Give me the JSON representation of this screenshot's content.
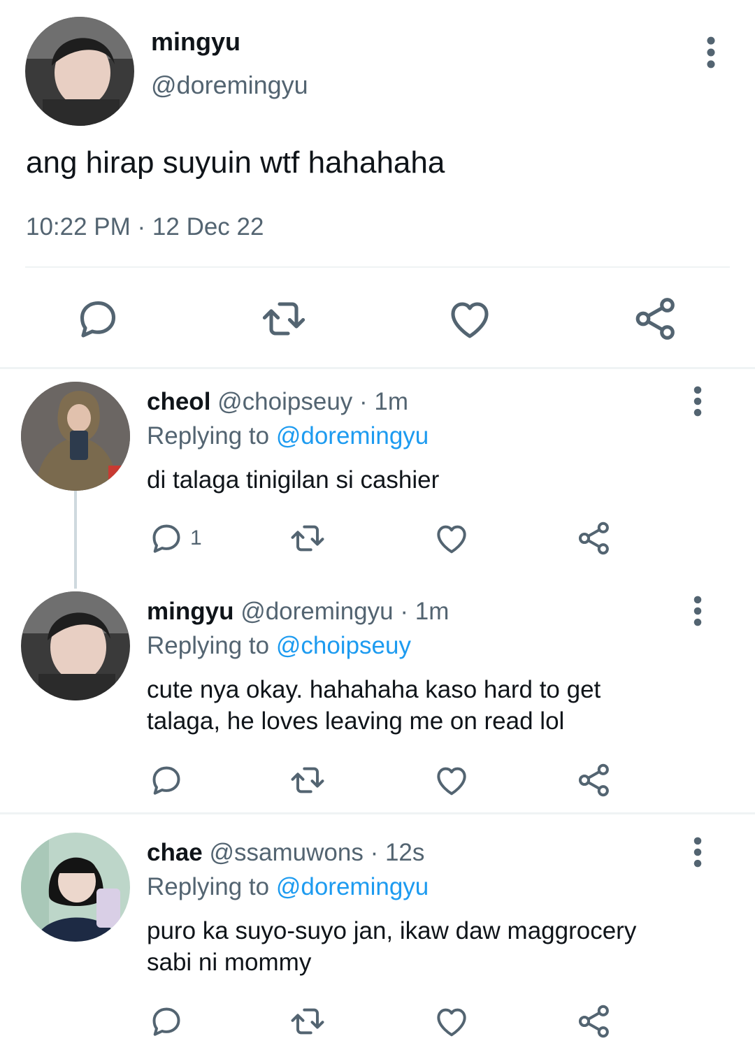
{
  "main_tweet": {
    "name": "mingyu",
    "handle": "@doremingyu",
    "text": "ang hirap suyuin wtf hahahaha",
    "timestamp": "10:22 PM · 12 Dec 22",
    "actions": [
      "reply-icon",
      "retweet-icon",
      "like-icon",
      "share-icon"
    ]
  },
  "replies": [
    {
      "name": "cheol",
      "handle": "@choipseuy",
      "time": "· 1m",
      "replying_label": "Replying to",
      "replying_to": "@doremingyu",
      "text": "di talaga tinigilan si cashier",
      "reply_count": "1"
    },
    {
      "name": "mingyu",
      "handle": "@doremingyu",
      "time": "· 1m",
      "replying_label": "Replying to",
      "replying_to": "@choipseuy",
      "text_lines": [
        "cute nya okay. hahahaha kaso hard to get",
        "talaga, he loves leaving me on read lol"
      ]
    },
    {
      "name": "chae",
      "handle": "@ssamuwons",
      "time": "· 12s",
      "replying_label": "Replying to",
      "replying_to": "@doremingyu",
      "text_lines": [
        "puro ka suyo-suyo jan, ikaw daw maggrocery",
        "sabi ni mommy"
      ]
    }
  ],
  "colors": {
    "text_primary": "#0f1419",
    "text_secondary": "#536471",
    "accent": "#1d9bf0",
    "divider": "#eff3f4",
    "thread_line": "#cfd9de"
  }
}
